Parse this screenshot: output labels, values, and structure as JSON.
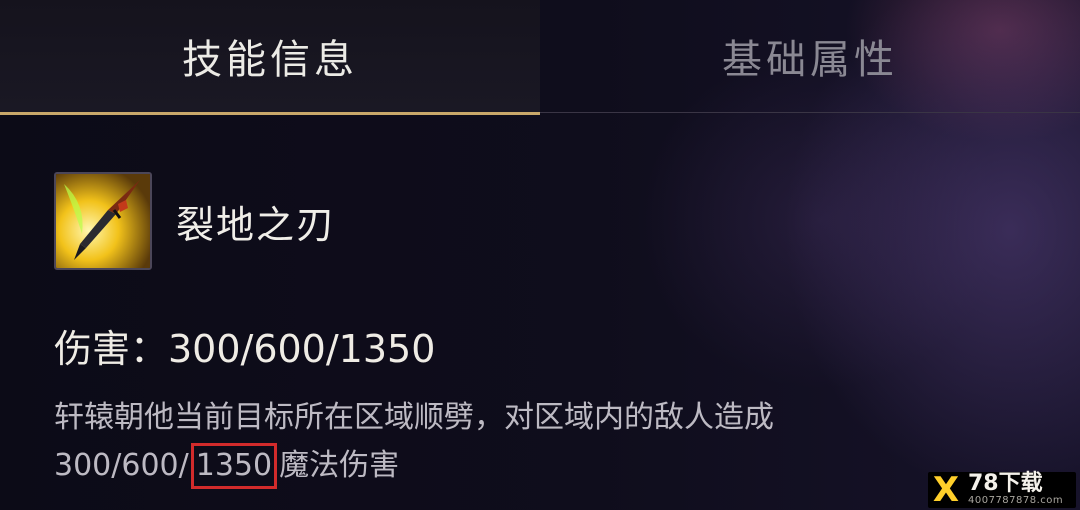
{
  "tabs": [
    {
      "label": "技能信息",
      "active": true
    },
    {
      "label": "基础属性",
      "active": false
    }
  ],
  "skill": {
    "icon": "blade-strike-icon",
    "name": "裂地之刃"
  },
  "damage_line": "伤害：300/600/1350",
  "description": {
    "line1": "轩辕朝他当前目标所在区域顺劈，对区域内的敌人造成",
    "line2_prefix": "300/600/",
    "line2_highlight": "1350",
    "line2_suffix": "魔法伤害"
  },
  "watermark": {
    "logo": "X",
    "main": "78下载",
    "sub": "4007787878.com"
  },
  "colors": {
    "accent": "#c9a86a",
    "highlight_box": "#d22b2b",
    "background": "#0d0c19"
  }
}
